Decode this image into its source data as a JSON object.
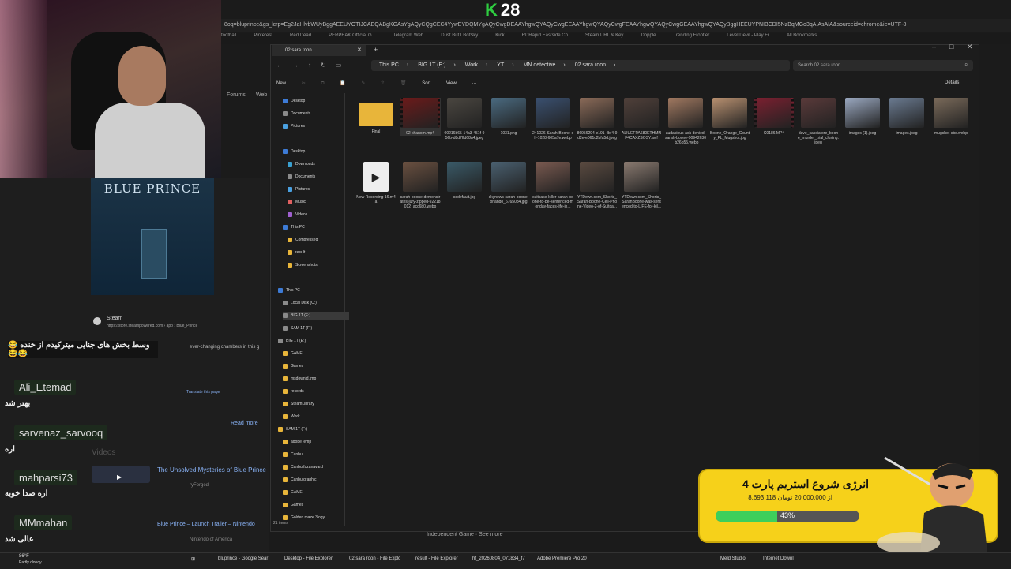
{
  "stream": {
    "counter_letter": "K",
    "counter_value": "28"
  },
  "browser": {
    "url": "8oq=bluprince&gs_lcrp=Eg2JaHlvbWUyBggAEEUYOTIJCAEQABgKGAsYgAQyCQgCEC4YywEYDQMYgAQyCwgDEAAYhgwQYAQyCwgEEAAYhgwQYAQyCwgFEAAYhgwQYAQyCwgGEAAYhgwQYAQyBggHEEUYPNIBCDI5NzBqMGo3qAIAsAIA&sourceid=chrome&ie=UTF-8",
    "bookmarks": [
      "football",
      "Pinterest",
      "Red Dead",
      "PERPEAK Official G...",
      "Telegram Web",
      "Dust But I BotSky",
      "Kick",
      "RDRapid Eastside Ch",
      "Steam URL & Key",
      "Dopple",
      "Trending Frontier",
      "Level Devil - Play Fr",
      "All Bookmarks"
    ],
    "left_nav": [
      "Forums",
      "Web"
    ]
  },
  "poster": {
    "title": "BLUE PRINCE"
  },
  "google": {
    "steam_title": "Steam",
    "steam_url": "https://store.steampowered.com › app › Blue_Prince",
    "ever_changing": "ever-changing chambers in this g",
    "translate": "Translate this page",
    "read_more": "Read more",
    "videos_heading": "Videos",
    "video1_title": "The Unsolved Mysteries of Blue Prince",
    "video1_channel": "ryForged",
    "video2_title": "Blue Prince – Launch Trailer – Nintendo",
    "video2_channel": "Nintendo of America",
    "independent": "Independent Game · See more"
  },
  "chat": [
    {
      "name": "",
      "text": "وسط بخش های جنایی میترکیدم از خنده 😂😂😂"
    },
    {
      "name": "Ali_Etemad",
      "text": "بهتر شد"
    },
    {
      "name": "sarvenaz_sarvooq",
      "text": "اره"
    },
    {
      "name": "mahparsi73",
      "text": "اره صدا خوبه"
    },
    {
      "name": "MMmahan",
      "text": "عالی شد"
    }
  ],
  "explorer": {
    "tab_title": "02 sara roon",
    "breadcrumb": [
      "This PC",
      "BIG 1T (E:)",
      "Work",
      "YT",
      "MN detective",
      "02 sara roon"
    ],
    "search_placeholder": "Search 02 sara roon",
    "toolbar": {
      "new": "New",
      "sort": "Sort",
      "view": "View",
      "more": "···",
      "details": "Details"
    },
    "status": "21 items",
    "nav": [
      "Desktop",
      "Documents",
      "Pictures",
      "Desktop",
      "Downloads",
      "Documents",
      "Pictures",
      "Music",
      "Videos",
      "This PC",
      "Compressed",
      "result",
      "Screenshots",
      "This PC",
      "Local Disk (C:)",
      "BIG 1T (E:)",
      "SAM 1T (F:)",
      "BIG 1T (E:)",
      "GAME",
      "Games",
      "msdownld.tmp",
      "records",
      "SteamLibrary",
      "Work",
      "SAM 1T (F:)",
      "adobeTemp",
      "Canbu",
      "Canbu fazanavard",
      "Canbu graphic",
      "GAME",
      "Games",
      "Golden maze 3logy"
    ],
    "files": [
      {
        "name": "Final",
        "kind": "folder",
        "color": "#e8b53a"
      },
      {
        "name": "02 khanom.mp4",
        "kind": "video",
        "color": "#6b1a1a"
      },
      {
        "name": "00216b65-14a3-451f-956b-d8d7ffd68a4.jpeg",
        "kind": "image",
        "color": "#4a4640"
      },
      {
        "name": "1031.png",
        "kind": "image",
        "color": "#4a6a80"
      },
      {
        "name": "241026-Sarah-Boone-ch-1028-605a7e.webp",
        "kind": "image",
        "color": "#3a5070"
      },
      {
        "name": "86956294-e191-4bf4-9d2e-e061c2bfa5d.jpeg",
        "kind": "image",
        "color": "#8a6a58"
      },
      {
        "name": "ALIUEFPA680ETHMNF4CAXZSOSY.avif",
        "kind": "image",
        "color": "#50403a"
      },
      {
        "name": "audacious-ask-denied-sarah-boone-90942630_b26b55.webp",
        "kind": "image",
        "color": "#a07860"
      },
      {
        "name": "Boone_Orange_County_FL_Mugshot.jpg",
        "kind": "image",
        "color": "#b89070"
      },
      {
        "name": "C0186.MP4",
        "kind": "video",
        "color": "#7a2030"
      },
      {
        "name": "dave_cacciatore_boone_murder_trial_closing.jpeg",
        "kind": "image",
        "color": "#5a3a3a"
      },
      {
        "name": "images (1).jpeg",
        "kind": "image",
        "color": "#9aa8c0"
      },
      {
        "name": "images.jpeg",
        "kind": "image",
        "color": "#6a7a90"
      },
      {
        "name": "mugshot-sbs.webp",
        "kind": "image",
        "color": "#7a6a5a"
      },
      {
        "name": "New Recording 16.m4a",
        "kind": "audio",
        "color": "#eeeeee"
      },
      {
        "name": "sarah-boone-demonstrates-jury-zipped-92218012_acc6b0.webp",
        "kind": "image",
        "color": "#6a5040"
      },
      {
        "name": "sddefault.jpg",
        "kind": "image",
        "color": "#3a5a68"
      },
      {
        "name": "skynews-sarah-boone-orlando_6765084.jpg",
        "kind": "image",
        "color": "#4a6070"
      },
      {
        "name": "suitcase-killer-sarah-boone-to-be-sentenced-monday-faces-life-in...",
        "kind": "image",
        "color": "#7a5a50"
      },
      {
        "name": "YTDown.com_Shorts_Sarah-Boone-Cell-Phone-Video-2-of-Suitca...",
        "kind": "image",
        "color": "#5a4a40"
      },
      {
        "name": "YTDown.com_Shorts_SarahBoone-was-sentenced-to-LIFE-for-kil...",
        "kind": "image",
        "color": "#8a7a70"
      }
    ]
  },
  "overlay": {
    "title": "انرژی شروع استریم پارت 4",
    "subtitle": "8,693,118 از 20,000,000 تومان",
    "percent_label": "43%",
    "progress": 0.43
  },
  "taskbar": {
    "weather_temp": "86°F",
    "weather_text": "Partly cloudy",
    "items": [
      "bluprince - Google Sear",
      "Desktop - File Explorer",
      "02 sara roon - File Explc",
      "result - File Explorer",
      "hf_20260804_071834_f7",
      "Adobe Premiere Pro 20",
      "Meld Studio",
      "Internet Downl"
    ]
  }
}
